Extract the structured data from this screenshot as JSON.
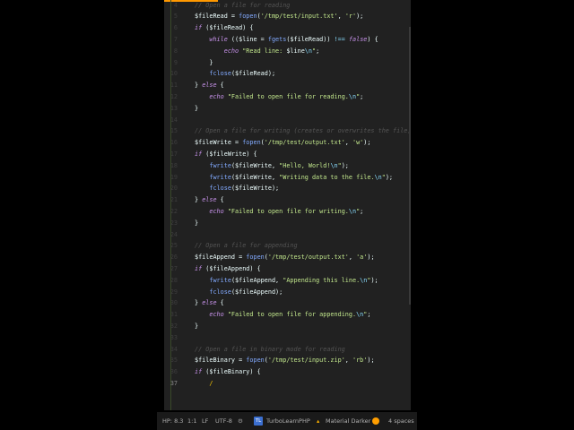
{
  "editor": {
    "theme_accent": "#ff9800",
    "current_line": 37,
    "first_line": 4,
    "lines": [
      [
        [
          "cm",
          "// Open a file for reading"
        ]
      ],
      [
        [
          "var",
          "$fileRead"
        ],
        [
          "p",
          " = "
        ],
        [
          "fn",
          "fopen"
        ],
        [
          "p",
          "("
        ],
        [
          "str",
          "'/tmp/test/input.txt'"
        ],
        [
          "p",
          ", "
        ],
        [
          "str",
          "'r'"
        ],
        [
          "p",
          ");"
        ]
      ],
      [
        [
          "kw",
          "if"
        ],
        [
          "p",
          " ("
        ],
        [
          "var",
          "$fileRead"
        ],
        [
          "p",
          ") {"
        ]
      ],
      [
        [
          "p",
          "    "
        ],
        [
          "kw",
          "while"
        ],
        [
          "p",
          " (("
        ],
        [
          "var",
          "$line"
        ],
        [
          "p",
          " = "
        ],
        [
          "fn",
          "fgets"
        ],
        [
          "p",
          "("
        ],
        [
          "var",
          "$fileRead"
        ],
        [
          "p",
          ")) "
        ],
        [
          "op",
          "!=="
        ],
        [
          "p",
          " "
        ],
        [
          "kw",
          "false"
        ],
        [
          "p",
          ") {"
        ]
      ],
      [
        [
          "p",
          "        "
        ],
        [
          "kw",
          "echo"
        ],
        [
          "p",
          " "
        ],
        [
          "str",
          "\"Read line: "
        ],
        [
          "var",
          "$line"
        ],
        [
          "esc",
          "\\n"
        ],
        [
          "str",
          "\""
        ],
        [
          "p",
          ";"
        ]
      ],
      [
        [
          "p",
          "    }"
        ]
      ],
      [
        [
          "p",
          "    "
        ],
        [
          "fn",
          "fclose"
        ],
        [
          "p",
          "("
        ],
        [
          "var",
          "$fileRead"
        ],
        [
          "p",
          ");"
        ]
      ],
      [
        [
          "p",
          "} "
        ],
        [
          "kw",
          "else"
        ],
        [
          "p",
          " {"
        ]
      ],
      [
        [
          "p",
          "    "
        ],
        [
          "kw",
          "echo"
        ],
        [
          "p",
          " "
        ],
        [
          "str",
          "\"Failed to open file for reading."
        ],
        [
          "esc",
          "\\n"
        ],
        [
          "str",
          "\""
        ],
        [
          "p",
          ";"
        ]
      ],
      [
        [
          "p",
          "}"
        ]
      ],
      [],
      [
        [
          "cm",
          "// Open a file for writing (creates or overwrites the file)"
        ]
      ],
      [
        [
          "var",
          "$fileWrite"
        ],
        [
          "p",
          " = "
        ],
        [
          "fn",
          "fopen"
        ],
        [
          "p",
          "("
        ],
        [
          "str",
          "'/tmp/test/output.txt'"
        ],
        [
          "p",
          ", "
        ],
        [
          "str",
          "'w'"
        ],
        [
          "p",
          ");"
        ]
      ],
      [
        [
          "kw",
          "if"
        ],
        [
          "p",
          " ("
        ],
        [
          "var",
          "$fileWrite"
        ],
        [
          "p",
          ") {"
        ]
      ],
      [
        [
          "p",
          "    "
        ],
        [
          "fn",
          "fwrite"
        ],
        [
          "p",
          "("
        ],
        [
          "var",
          "$fileWrite"
        ],
        [
          "p",
          ", "
        ],
        [
          "str",
          "\"Hello, World!"
        ],
        [
          "esc",
          "\\n"
        ],
        [
          "str",
          "\""
        ],
        [
          "p",
          ");"
        ]
      ],
      [
        [
          "p",
          "    "
        ],
        [
          "fn",
          "fwrite"
        ],
        [
          "p",
          "("
        ],
        [
          "var",
          "$fileWrite"
        ],
        [
          "p",
          ", "
        ],
        [
          "str",
          "\"Writing data to the file."
        ],
        [
          "esc",
          "\\n"
        ],
        [
          "str",
          "\""
        ],
        [
          "p",
          ");"
        ]
      ],
      [
        [
          "p",
          "    "
        ],
        [
          "fn",
          "fclose"
        ],
        [
          "p",
          "("
        ],
        [
          "var",
          "$fileWrite"
        ],
        [
          "p",
          ");"
        ]
      ],
      [
        [
          "p",
          "} "
        ],
        [
          "kw",
          "else"
        ],
        [
          "p",
          " {"
        ]
      ],
      [
        [
          "p",
          "    "
        ],
        [
          "kw",
          "echo"
        ],
        [
          "p",
          " "
        ],
        [
          "str",
          "\"Failed to open file for writing."
        ],
        [
          "esc",
          "\\n"
        ],
        [
          "str",
          "\""
        ],
        [
          "p",
          ";"
        ]
      ],
      [
        [
          "p",
          "}"
        ]
      ],
      [],
      [
        [
          "cm",
          "// Open a file for appending"
        ]
      ],
      [
        [
          "var",
          "$fileAppend"
        ],
        [
          "p",
          " = "
        ],
        [
          "fn",
          "fopen"
        ],
        [
          "p",
          "("
        ],
        [
          "str",
          "'/tmp/test/output.txt'"
        ],
        [
          "p",
          ", "
        ],
        [
          "str",
          "'a'"
        ],
        [
          "p",
          ");"
        ]
      ],
      [
        [
          "kw",
          "if"
        ],
        [
          "p",
          " ("
        ],
        [
          "var",
          "$fileAppend"
        ],
        [
          "p",
          ") {"
        ]
      ],
      [
        [
          "p",
          "    "
        ],
        [
          "fn",
          "fwrite"
        ],
        [
          "p",
          "("
        ],
        [
          "var",
          "$fileAppend"
        ],
        [
          "p",
          ", "
        ],
        [
          "str",
          "\"Appending this line."
        ],
        [
          "esc",
          "\\n"
        ],
        [
          "str",
          "\""
        ],
        [
          "p",
          ");"
        ]
      ],
      [
        [
          "p",
          "    "
        ],
        [
          "fn",
          "fclose"
        ],
        [
          "p",
          "("
        ],
        [
          "var",
          "$fileAppend"
        ],
        [
          "p",
          ");"
        ]
      ],
      [
        [
          "p",
          "} "
        ],
        [
          "kw",
          "else"
        ],
        [
          "p",
          " {"
        ]
      ],
      [
        [
          "p",
          "    "
        ],
        [
          "kw",
          "echo"
        ],
        [
          "p",
          " "
        ],
        [
          "str",
          "\"Failed to open file for appending."
        ],
        [
          "esc",
          "\\n"
        ],
        [
          "str",
          "\""
        ],
        [
          "p",
          ";"
        ]
      ],
      [
        [
          "p",
          "}"
        ]
      ],
      [],
      [
        [
          "cm",
          "// Open a file in binary mode for reading"
        ]
      ],
      [
        [
          "var",
          "$fileBinary"
        ],
        [
          "p",
          " = "
        ],
        [
          "fn",
          "fopen"
        ],
        [
          "p",
          "("
        ],
        [
          "str",
          "'/tmp/test/input.zip'"
        ],
        [
          "p",
          ", "
        ],
        [
          "str",
          "'rb'"
        ],
        [
          "p",
          ");"
        ]
      ],
      [
        [
          "kw",
          "if"
        ],
        [
          "p",
          " ("
        ],
        [
          "var",
          "$fileBinary"
        ],
        [
          "p",
          ") {"
        ]
      ],
      [
        [
          "p",
          "    "
        ],
        [
          "cur",
          "/"
        ]
      ]
    ]
  },
  "status": {
    "php_version": "HP: 8.3",
    "position": "1:1",
    "line_ending": "LF",
    "encoding": "UTF-8",
    "plugin_badge": "TL",
    "plugin_name": "TurboLearnPHP",
    "theme_name": "Material Darker",
    "indent": "4 spaces"
  }
}
